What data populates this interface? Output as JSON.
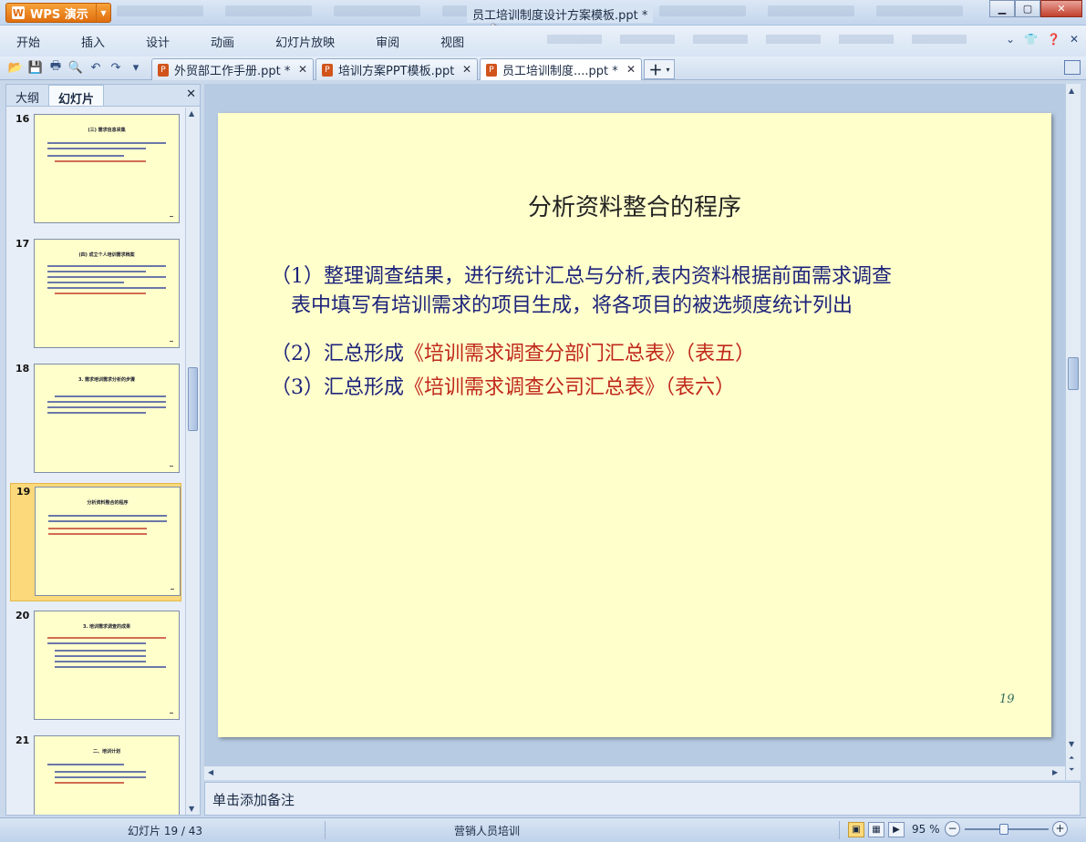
{
  "app": {
    "button_label": "WPS 演示",
    "window_title": "员工培训制度设计方案模板.ppt *"
  },
  "menu": [
    "开始",
    "插入",
    "设计",
    "动画",
    "幻灯片放映",
    "审阅",
    "视图"
  ],
  "doc_tabs": [
    {
      "label": "外贸部工作手册.ppt *"
    },
    {
      "label": "培训方案PPT模板.ppt"
    },
    {
      "label": "员工培训制度....ppt *"
    }
  ],
  "left_panel": {
    "tabs": [
      "大纲",
      "幻灯片"
    ],
    "slide_numbers": [
      "16",
      "17",
      "18",
      "19",
      "20",
      "21"
    ],
    "thumb_titles": [
      "(三) 需求信息采集",
      "(四) 成立个人培训需求档案",
      "3. 需求培训需求分析的步骤",
      "分析资料整合的程序",
      "3. 培训需求调查的成果",
      "二、培训计划"
    ]
  },
  "slide": {
    "title": "分析资料整合的程序",
    "p1_line1": "（1）整理调查结果，进行统计汇总与分析,表内资料根据前面需求调查",
    "p1_line2": "表中填写有培训需求的项目生成，将各项目的被选频度统计列出",
    "p2_prefix": "（2）汇总形成",
    "p2_red": "《培训需求调查分部门汇总表》（表五）",
    "p3_prefix": "（3）汇总形成",
    "p3_red": "《培训需求调查公司汇总表》（表六）",
    "page_number": "19"
  },
  "notes_placeholder": "单击添加备注",
  "status": {
    "slide_count": "幻灯片 19 / 43",
    "theme": "营销人员培训",
    "zoom": "95 %"
  },
  "colors": {
    "slide_bg": "#ffffcc",
    "body_text": "#1d237a",
    "highlight_red": "#c0281b",
    "selected_thumb": "#fcd97a"
  }
}
